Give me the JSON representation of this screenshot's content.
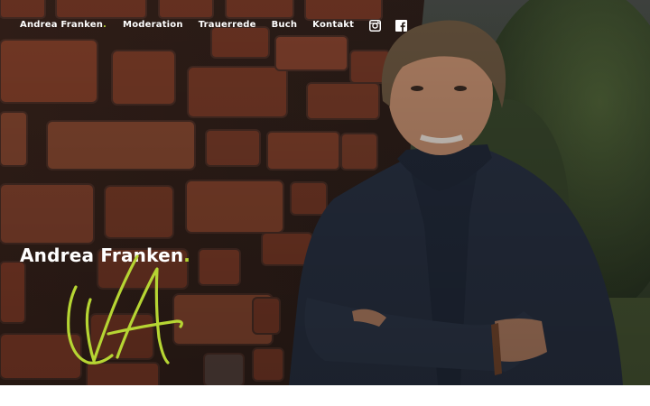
{
  "nav": {
    "brand": "Andrea Franken",
    "brand_dot": ".",
    "items": [
      {
        "label": "Moderation"
      },
      {
        "label": "Trauerrede"
      },
      {
        "label": "Buch"
      },
      {
        "label": "Kontakt"
      }
    ],
    "social": [
      {
        "icon": "instagram-icon"
      },
      {
        "icon": "facebook-icon"
      }
    ]
  },
  "hero": {
    "logo_name": "Andrea Franken",
    "logo_dot": ".",
    "signature_icon": "signature-af-icon"
  },
  "colors": {
    "accent": "#b6d533",
    "nav_text": "#ffffff",
    "background": "#ffffff"
  }
}
